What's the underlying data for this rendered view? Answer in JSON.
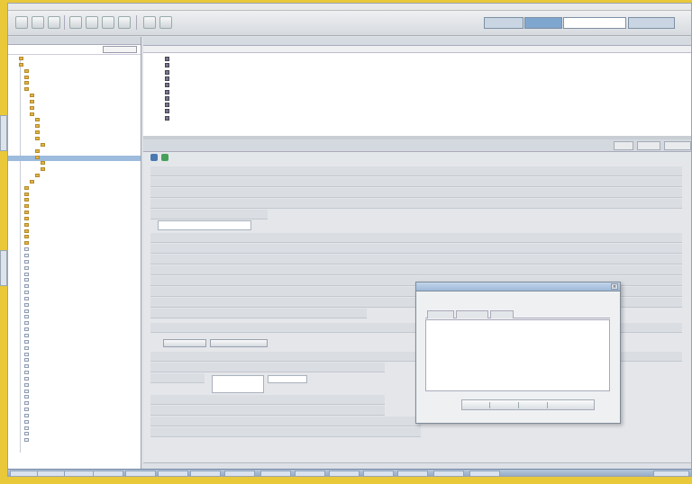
{
  "toolbar": {
    "fields": [
      "",
      "",
      "",
      ""
    ]
  },
  "nav": {
    "header": "",
    "items": [
      "",
      "",
      "",
      "",
      "",
      "",
      "",
      "",
      "",
      "",
      "",
      "",
      "",
      "",
      "",
      "",
      "",
      "",
      "",
      "",
      "",
      "",
      "",
      "",
      "",
      "",
      "",
      "",
      "",
      "",
      "",
      "",
      "",
      "",
      "",
      "",
      "",
      "",
      "",
      "",
      "",
      "",
      "",
      "",
      "",
      "",
      "",
      "",
      "",
      "",
      "",
      "",
      "",
      "",
      "",
      "",
      "",
      "",
      "",
      "",
      "",
      "",
      ""
    ]
  },
  "list": {
    "header": "",
    "columns": [
      "",
      "",
      "",
      "",
      ""
    ],
    "rows": [
      {
        "name": "",
        "path": "",
        "type": "",
        "size": "",
        "date": ""
      },
      {
        "name": "",
        "path": "",
        "type": "",
        "size": "",
        "date": ""
      },
      {
        "name": "",
        "path": "",
        "type": "",
        "size": "",
        "date": ""
      },
      {
        "name": "",
        "path": "",
        "type": "",
        "size": "",
        "date": ""
      },
      {
        "name": "",
        "path": "",
        "type": "",
        "size": "",
        "date": ""
      },
      {
        "name": "",
        "path": "",
        "type": "",
        "size": "",
        "date": ""
      },
      {
        "name": "",
        "path": "",
        "type": "",
        "size": "",
        "date": ""
      },
      {
        "name": "",
        "path": "",
        "type": "",
        "size": "",
        "date": ""
      },
      {
        "name": "",
        "path": "",
        "type": "",
        "size": "",
        "date": ""
      },
      {
        "name": "",
        "path": "",
        "type": "",
        "size": "",
        "date": ""
      }
    ]
  },
  "props": {
    "title": "",
    "tabs": [
      "",
      "",
      ""
    ],
    "sections": [
      "",
      "",
      "",
      "",
      "",
      "",
      "",
      "",
      "",
      "",
      "",
      "",
      "",
      "",
      "",
      "",
      "",
      "",
      "",
      "",
      ""
    ],
    "buttons": [
      "",
      ""
    ]
  },
  "dialog": {
    "title": "",
    "subtitle": "",
    "tabs": [
      "",
      "",
      ""
    ],
    "rows": [
      {
        "c1": "",
        "c2": "",
        "c3": "",
        "c4": ""
      },
      {
        "c1": "",
        "c2": "",
        "c3": "",
        "c4": ""
      },
      {
        "c1": "",
        "c2": "",
        "c3": "",
        "c4": ""
      }
    ],
    "button": ""
  },
  "taskbar": {
    "items": [
      "",
      "",
      "",
      "",
      "",
      "",
      "",
      "",
      "",
      "",
      "",
      "",
      "",
      "",
      ""
    ],
    "clock": ""
  }
}
